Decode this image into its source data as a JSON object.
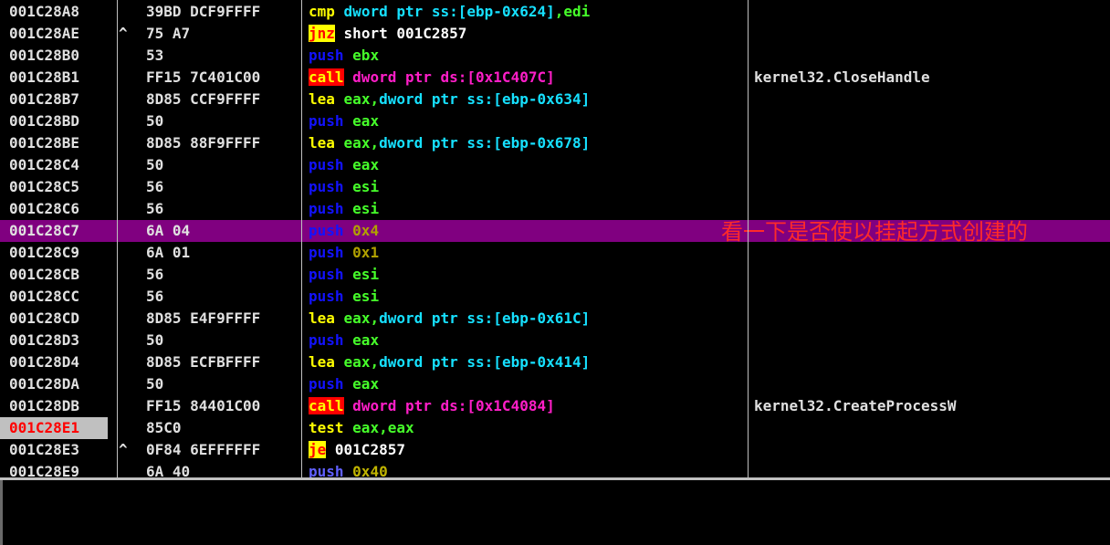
{
  "rows": [
    {
      "addr": "001C28A8",
      "mark": "",
      "bytes": "39BD DCF9FFFF",
      "mn": "cmp",
      "mn_style": "kw-y",
      "sep": " ",
      "ops": [
        {
          "t": "dword ptr ss:[ebp-0x624]",
          "s": "op-cyan"
        },
        {
          "t": ",edi",
          "s": "op-green"
        }
      ],
      "comment": "",
      "sel": false,
      "eip": false
    },
    {
      "addr": "001C28AE",
      "mark": "^",
      "bytes": "75 A7",
      "mn": "jnz",
      "mn_style": "kw-j",
      "sep": " ",
      "ops": [
        {
          "t": "short 001C2857",
          "s": "op-white"
        }
      ],
      "comment": "",
      "sel": false,
      "eip": false
    },
    {
      "addr": "001C28B0",
      "mark": "",
      "bytes": "53",
      "mn": "push",
      "mn_style": "kw-blue",
      "sep": " ",
      "ops": [
        {
          "t": "ebx",
          "s": "op-green"
        }
      ],
      "comment": "",
      "sel": false,
      "eip": false
    },
    {
      "addr": "001C28B1",
      "mark": "",
      "bytes": "FF15 7C401C00",
      "mn": "call",
      "mn_style": "kw-call",
      "sep": " ",
      "ops": [
        {
          "t": "dword ptr ds:[0x1C407C]",
          "s": "op-magenta"
        }
      ],
      "comment": "kernel32.CloseHandle",
      "sel": false,
      "eip": false
    },
    {
      "addr": "001C28B7",
      "mark": "",
      "bytes": "8D85 CCF9FFFF",
      "mn": "lea",
      "mn_style": "kw-y",
      "sep": " ",
      "ops": [
        {
          "t": "eax,",
          "s": "op-green"
        },
        {
          "t": "dword ptr ss:[ebp-0x634]",
          "s": "op-cyan"
        }
      ],
      "comment": "",
      "sel": false,
      "eip": false
    },
    {
      "addr": "001C28BD",
      "mark": "",
      "bytes": "50",
      "mn": "push",
      "mn_style": "kw-blue",
      "sep": " ",
      "ops": [
        {
          "t": "eax",
          "s": "op-green"
        }
      ],
      "comment": "",
      "sel": false,
      "eip": false
    },
    {
      "addr": "001C28BE",
      "mark": "",
      "bytes": "8D85 88F9FFFF",
      "mn": "lea",
      "mn_style": "kw-y",
      "sep": " ",
      "ops": [
        {
          "t": "eax,",
          "s": "op-green"
        },
        {
          "t": "dword ptr ss:[ebp-0x678]",
          "s": "op-cyan"
        }
      ],
      "comment": "",
      "sel": false,
      "eip": false
    },
    {
      "addr": "001C28C4",
      "mark": "",
      "bytes": "50",
      "mn": "push",
      "mn_style": "kw-blue",
      "sep": " ",
      "ops": [
        {
          "t": "eax",
          "s": "op-green"
        }
      ],
      "comment": "",
      "sel": false,
      "eip": false
    },
    {
      "addr": "001C28C5",
      "mark": "",
      "bytes": "56",
      "mn": "push",
      "mn_style": "kw-blue",
      "sep": " ",
      "ops": [
        {
          "t": "esi",
          "s": "op-green"
        }
      ],
      "comment": "",
      "sel": false,
      "eip": false
    },
    {
      "addr": "001C28C6",
      "mark": "",
      "bytes": "56",
      "mn": "push",
      "mn_style": "kw-blue",
      "sep": " ",
      "ops": [
        {
          "t": "esi",
          "s": "op-green"
        }
      ],
      "comment": "",
      "sel": false,
      "eip": false
    },
    {
      "addr": "001C28C7",
      "mark": "",
      "bytes": "6A 04",
      "mn": "push",
      "mn_style": "kw-blue",
      "sep": " ",
      "ops": [
        {
          "t": "0x4",
          "s": "op-olive"
        }
      ],
      "comment": "",
      "sel": true,
      "eip": false
    },
    {
      "addr": "001C28C9",
      "mark": "",
      "bytes": "6A 01",
      "mn": "push",
      "mn_style": "kw-blue",
      "sep": " ",
      "ops": [
        {
          "t": "0x1",
          "s": "op-olive"
        }
      ],
      "comment": "",
      "sel": false,
      "eip": false
    },
    {
      "addr": "001C28CB",
      "mark": "",
      "bytes": "56",
      "mn": "push",
      "mn_style": "kw-blue",
      "sep": " ",
      "ops": [
        {
          "t": "esi",
          "s": "op-green"
        }
      ],
      "comment": "",
      "sel": false,
      "eip": false
    },
    {
      "addr": "001C28CC",
      "mark": "",
      "bytes": "56",
      "mn": "push",
      "mn_style": "kw-blue",
      "sep": " ",
      "ops": [
        {
          "t": "esi",
          "s": "op-green"
        }
      ],
      "comment": "",
      "sel": false,
      "eip": false
    },
    {
      "addr": "001C28CD",
      "mark": "",
      "bytes": "8D85 E4F9FFFF",
      "mn": "lea",
      "mn_style": "kw-y",
      "sep": " ",
      "ops": [
        {
          "t": "eax,",
          "s": "op-green"
        },
        {
          "t": "dword ptr ss:[ebp-0x61C]",
          "s": "op-cyan"
        }
      ],
      "comment": "",
      "sel": false,
      "eip": false
    },
    {
      "addr": "001C28D3",
      "mark": "",
      "bytes": "50",
      "mn": "push",
      "mn_style": "kw-blue",
      "sep": " ",
      "ops": [
        {
          "t": "eax",
          "s": "op-green"
        }
      ],
      "comment": "",
      "sel": false,
      "eip": false
    },
    {
      "addr": "001C28D4",
      "mark": "",
      "bytes": "8D85 ECFBFFFF",
      "mn": "lea",
      "mn_style": "kw-y",
      "sep": " ",
      "ops": [
        {
          "t": "eax,",
          "s": "op-green"
        },
        {
          "t": "dword ptr ss:[ebp-0x414]",
          "s": "op-cyan"
        }
      ],
      "comment": "",
      "sel": false,
      "eip": false
    },
    {
      "addr": "001C28DA",
      "mark": "",
      "bytes": "50",
      "mn": "push",
      "mn_style": "kw-blue",
      "sep": " ",
      "ops": [
        {
          "t": "eax",
          "s": "op-green"
        }
      ],
      "comment": "",
      "sel": false,
      "eip": false
    },
    {
      "addr": "001C28DB",
      "mark": "",
      "bytes": "FF15 84401C00",
      "mn": "call",
      "mn_style": "kw-call",
      "sep": " ",
      "ops": [
        {
          "t": "dword ptr ds:[0x1C4084]",
          "s": "op-magenta"
        }
      ],
      "comment": "kernel32.CreateProcessW",
      "sel": false,
      "eip": false
    },
    {
      "addr": "001C28E1",
      "mark": "",
      "bytes": "85C0",
      "mn": "test",
      "mn_style": "kw-y",
      "sep": " ",
      "ops": [
        {
          "t": "eax,eax",
          "s": "op-green"
        }
      ],
      "comment": "",
      "sel": false,
      "eip": true
    },
    {
      "addr": "001C28E3",
      "mark": "^",
      "bytes": "0F84 6EFFFFFF",
      "mn": "je",
      "mn_style": "kw-j",
      "sep": " ",
      "ops": [
        {
          "t": "001C2857",
          "s": "op-white"
        }
      ],
      "comment": "",
      "sel": false,
      "eip": false
    },
    {
      "addr": "001C28E9",
      "mark": "",
      "bytes": "6A 40",
      "mn": "push",
      "mn_style": "kw-ghost",
      "sep": " ",
      "ops": [
        {
          "t": "0x40",
          "s": "op-ghost"
        }
      ],
      "comment": "",
      "sel": false,
      "eip": false
    }
  ],
  "annotation": "看一下是否使以挂起方式创建的",
  "colors": {
    "background": "#000000",
    "selected_row": "#800080",
    "eip_address_bg": "#c0c0c0",
    "eip_address_text": "#ff0000",
    "annotation_text": "#ff2a2a"
  }
}
